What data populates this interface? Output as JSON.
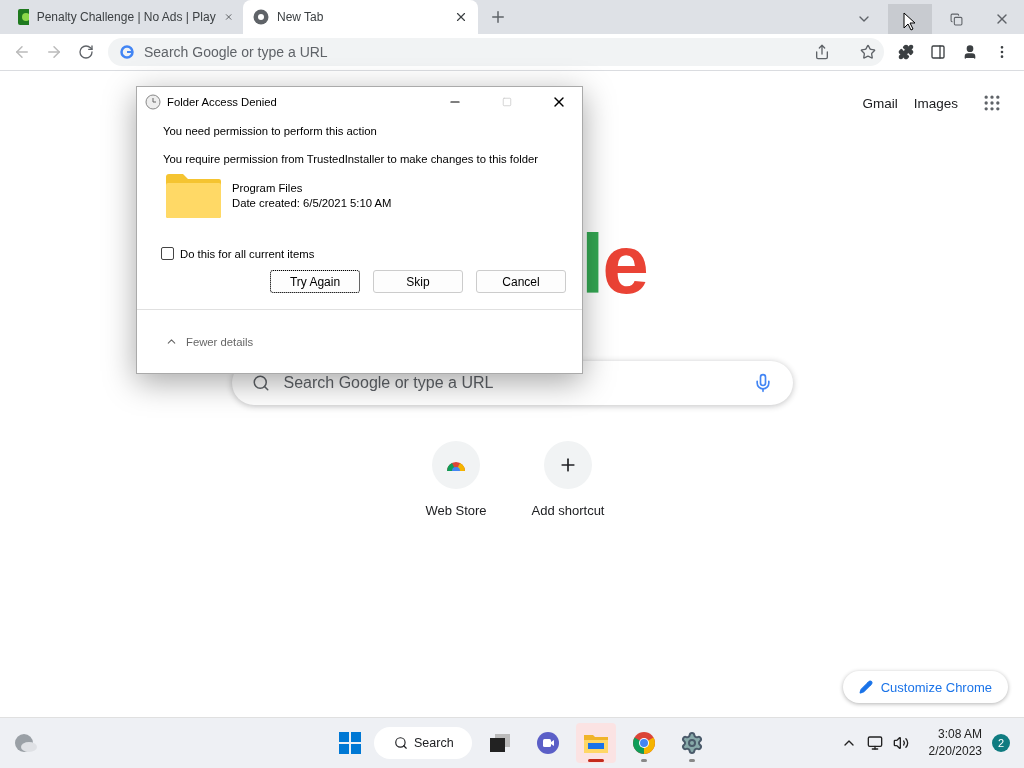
{
  "browser": {
    "tabs": [
      {
        "title": "Penalty Challenge | No Ads | Play",
        "selected": false
      },
      {
        "title": "New Tab",
        "selected": true
      }
    ],
    "window_buttons": [
      {
        "kind": "tabsearch",
        "hovered": false
      },
      {
        "kind": "minimize",
        "hovered": true
      },
      {
        "kind": "restore",
        "hovered": false
      },
      {
        "kind": "close",
        "hovered": false
      }
    ],
    "omnibox": {
      "placeholder": "Search Google or type a URL"
    }
  },
  "new_tab_page": {
    "header_links": [
      "Gmail",
      "Images"
    ],
    "logo": [
      {
        "char": "l",
        "color": "#34a853"
      },
      {
        "char": "e",
        "color": "#ea4335"
      }
    ],
    "search": {
      "placeholder": "Search Google or type a URL"
    },
    "shortcuts": [
      {
        "kind": "webstore",
        "label": "Web Store"
      },
      {
        "kind": "add",
        "label": "Add shortcut"
      }
    ],
    "customize_button": "Customize Chrome"
  },
  "dialog": {
    "title": "Folder Access Denied",
    "heading": "You need permission to perform this action",
    "message": "You require permission from TrustedInstaller to make changes to this folder",
    "item": {
      "name": "Program Files",
      "date": "Date created: 6/5/2021 5:10 AM"
    },
    "checkbox": {
      "label": "Do this for all current items",
      "checked": false
    },
    "buttons": [
      {
        "label": "Try Again",
        "focused": true
      },
      {
        "label": "Skip",
        "focused": false
      },
      {
        "label": "Cancel",
        "focused": false
      }
    ],
    "details": {
      "label": "Fewer details",
      "expanded": true
    }
  },
  "taskbar": {
    "search": "Search",
    "apps": [
      {
        "kind": "taskview",
        "running": false,
        "active": false
      },
      {
        "kind": "chat",
        "running": false,
        "active": false
      },
      {
        "kind": "explorer",
        "running": true,
        "active": true
      },
      {
        "kind": "chrome",
        "running": true,
        "active": false
      },
      {
        "kind": "settings",
        "running": true,
        "active": false
      }
    ],
    "time": "3:08 AM",
    "date": "2/20/2023",
    "notifications": "2"
  }
}
